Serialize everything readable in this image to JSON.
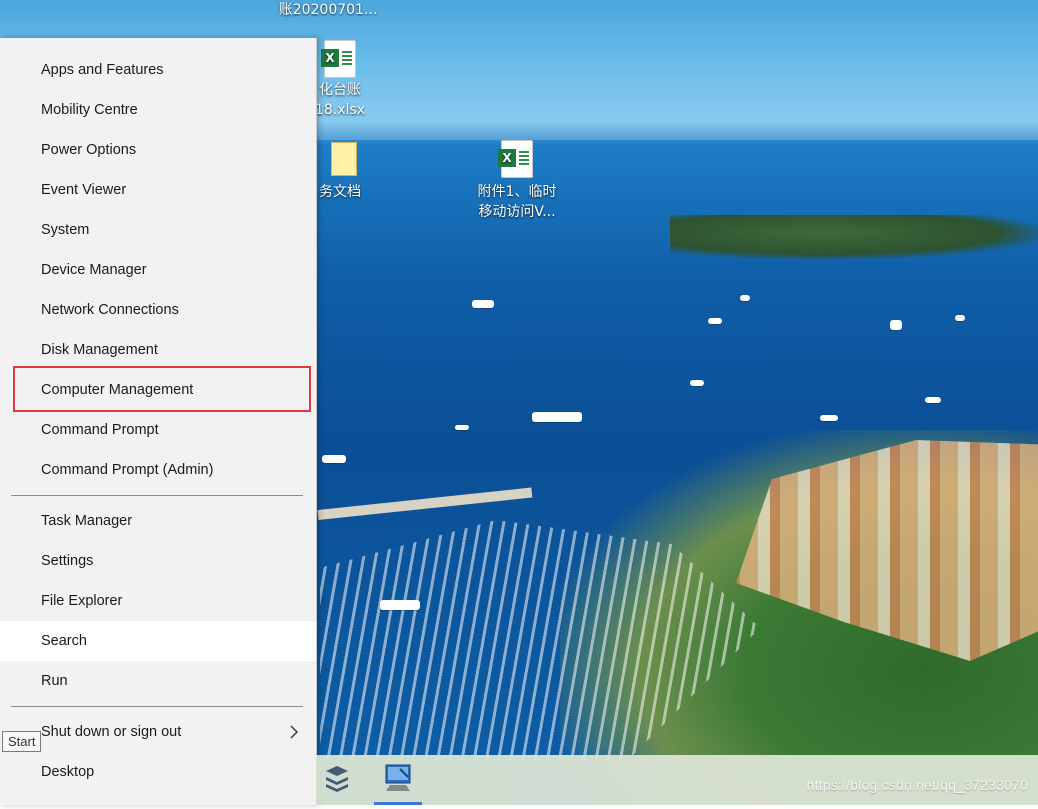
{
  "desktop": {
    "icons": [
      {
        "label": "账20200701..."
      },
      {
        "label_line1": "化台账",
        "label_line2": "18.xlsx"
      },
      {
        "label": "务文档"
      },
      {
        "label_line1": "附件1、临时",
        "label_line2": "移动访问V..."
      }
    ],
    "watermark": "https://blog.csdn.net/qq_37233070"
  },
  "menu": {
    "items": [
      {
        "label": "Apps and Features"
      },
      {
        "label": "Mobility Centre"
      },
      {
        "label": "Power Options"
      },
      {
        "label": "Event Viewer"
      },
      {
        "label": "System"
      },
      {
        "label": "Device Manager"
      },
      {
        "label": "Network Connections"
      },
      {
        "label": "Disk Management"
      },
      {
        "label": "Computer Management"
      },
      {
        "label": "Command Prompt"
      },
      {
        "label": "Command Prompt (Admin)"
      },
      {
        "label": "Task Manager"
      },
      {
        "label": "Settings"
      },
      {
        "label": "File Explorer"
      },
      {
        "label": "Search"
      },
      {
        "label": "Run"
      },
      {
        "label": "Shut down or sign out"
      },
      {
        "label": "Desktop"
      }
    ],
    "highlighted": "Computer Management",
    "hovered": "Search"
  },
  "tooltip": {
    "text": "Start"
  },
  "colors": {
    "highlight_border": "#e0393e",
    "menu_bg": "#f2f2f2",
    "taskbar_active": "#3a7bd5"
  }
}
